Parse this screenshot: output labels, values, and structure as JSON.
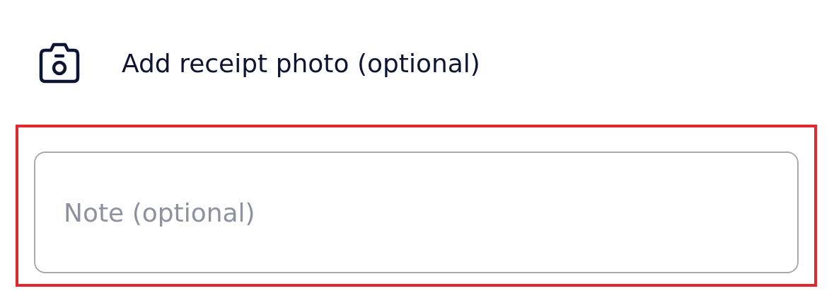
{
  "receipt_action": {
    "label": "Add receipt photo (optional)"
  },
  "note_field": {
    "placeholder": "Note (optional)",
    "highlighted": true
  }
}
